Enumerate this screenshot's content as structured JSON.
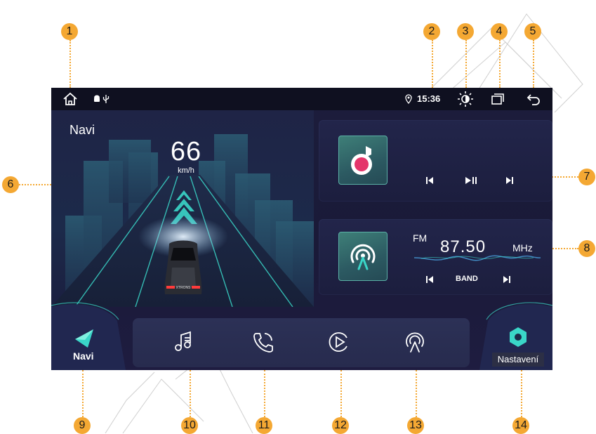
{
  "status_bar": {
    "time": "15:36",
    "icons": [
      "home-icon",
      "android-icon",
      "usb-icon",
      "location-icon",
      "brightness-icon",
      "recent-apps-icon",
      "back-icon"
    ]
  },
  "navigation": {
    "title": "Navi",
    "speed": "66",
    "speed_unit": "km/h",
    "car_badge": "XTRONS"
  },
  "music_card": {
    "icon": "music-app-icon",
    "controls": [
      "previous-icon",
      "play-pause-icon",
      "next-icon"
    ]
  },
  "radio_card": {
    "icon": "radio-app-icon",
    "band": "FM",
    "frequency": "87.50",
    "unit": "MHz",
    "band_button": "BAND"
  },
  "dock": {
    "left_label": "Navi",
    "right_label": "Nastavení",
    "icons": [
      "music-icon",
      "phone-icon",
      "video-icon",
      "radio-icon"
    ]
  },
  "callouts": [
    "1",
    "2",
    "3",
    "4",
    "5",
    "6",
    "7",
    "8",
    "9",
    "10",
    "11",
    "12",
    "13",
    "14"
  ],
  "colors": {
    "accent": "#f4a833",
    "teal": "#3ad6c8",
    "screen_bg": "#1c1d3c"
  }
}
